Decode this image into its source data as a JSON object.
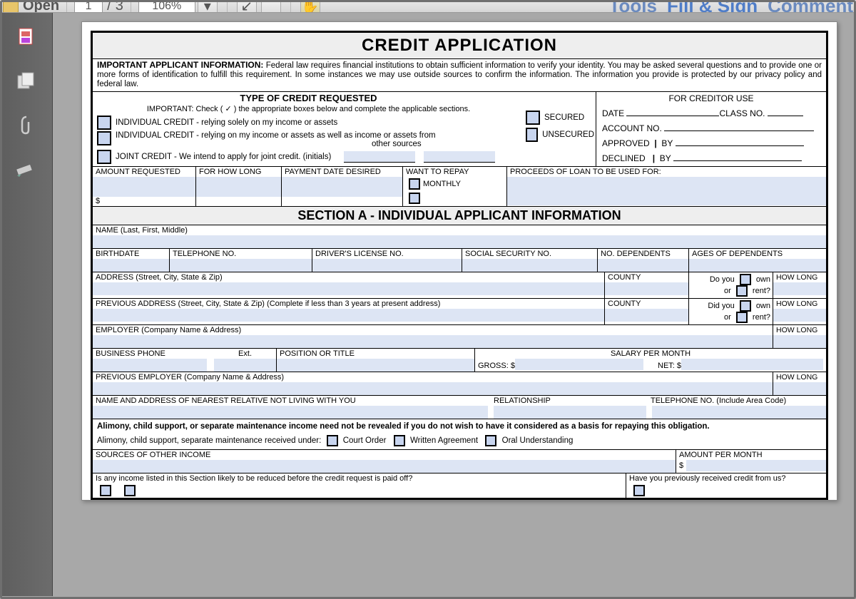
{
  "toolbar": {
    "open": "Open",
    "page_current": "1",
    "page_sep": "/",
    "page_total": "3",
    "zoom": "106%",
    "tools": "Tools",
    "fill_sign": "Fill & Sign",
    "comment": "Comment"
  },
  "form": {
    "title": "CREDIT APPLICATION",
    "notice_label": "IMPORTANT APPLICANT INFORMATION:",
    "notice_text": "Federal law requires financial institutions to obtain sufficient information to verify your identity. You may be asked several questions and to provide one or more forms of identification to fulfill this requirement. In some instances we may use outside sources to confirm the information. The information you provide is protected by our privacy policy and federal law.",
    "toc": {
      "header": "TYPE OF CREDIT REQUESTED",
      "sub": "IMPORTANT: Check ( ✓ ) the appropriate boxes below and complete the applicable sections.",
      "ind1": "INDIVIDUAL CREDIT - relying solely on my income or assets",
      "ind2a": "INDIVIDUAL CREDIT - relying on my income or assets as well as income or assets from",
      "ind2b": "other sources",
      "joint": "JOINT CREDIT - We intend to apply for joint credit. (initials)",
      "secured": "SECURED",
      "unsecured": "UNSECURED"
    },
    "creditor": {
      "header": "FOR CREDITOR USE",
      "date": "DATE",
      "class_no": "CLASS NO.",
      "account_no": "ACCOUNT NO.",
      "approved": "APPROVED",
      "declined": "DECLINED",
      "by": "BY"
    },
    "amount": {
      "requested": "AMOUNT REQUESTED",
      "dollar": "$",
      "how_long": "FOR HOW LONG",
      "payment_date": "PAYMENT DATE DESIRED",
      "want_repay": "WANT TO REPAY",
      "monthly": "MONTHLY",
      "proceeds": "PROCEEDS OF LOAN TO BE USED FOR:"
    },
    "section_a": "SECTION A - INDIVIDUAL APPLICANT INFORMATION",
    "fields": {
      "name": "NAME (Last, First, Middle)",
      "birthdate": "BIRTHDATE",
      "telephone": "TELEPHONE NO.",
      "dl": "DRIVER'S LICENSE NO.",
      "ssn": "SOCIAL SECURITY NO.",
      "dependents": "NO. DEPENDENTS",
      "ages_dep": "AGES OF DEPENDENTS",
      "address": "ADDRESS (Street, City, State & Zip)",
      "county": "COUNTY",
      "do_you": "Do you",
      "did_you": "Did you",
      "own": "own",
      "or": "or",
      "rent": "rent?",
      "how_long": "HOW LONG",
      "prev_address": "PREVIOUS ADDRESS (Street, City, State & Zip) (Complete if less than 3 years at present address)",
      "employer": "EMPLOYER (Company Name & Address)",
      "bus_phone": "BUSINESS PHONE",
      "ext": "Ext.",
      "position": "POSITION OR TITLE",
      "salary": "SALARY PER MONTH",
      "gross": "GROSS: $",
      "net": "NET: $",
      "prev_employer": "PREVIOUS EMPLOYER (Company Name & Address)",
      "relative": "NAME AND ADDRESS OF NEAREST RELATIVE NOT LIVING WITH YOU",
      "relationship": "RELATIONSHIP",
      "tel_area": "TELEPHONE NO. (Include Area Code)",
      "alimony_note": "Alimony, child support, or separate maintenance income need not be revealed if you do not wish to have it considered as a basis for repaying this obligation.",
      "alimony_received": "Alimony, child support, separate maintenance received under:",
      "court_order": "Court Order",
      "written_agreement": "Written Agreement",
      "oral": "Oral Understanding",
      "other_income": "SOURCES OF OTHER INCOME",
      "amt_per_month": "AMOUNT PER MONTH",
      "dollar2": "$",
      "reduce_q": "Is any income listed in this Section likely to be reduced before the credit request is paid off?",
      "prev_credit_q": "Have you previously received credit from us?"
    }
  }
}
